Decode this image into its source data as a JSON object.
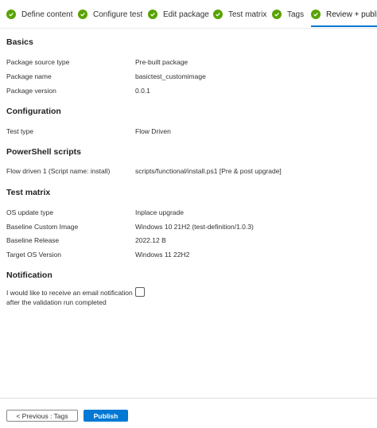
{
  "wizard": {
    "steps": [
      {
        "label": "Define content",
        "status": "complete"
      },
      {
        "label": "Configure test",
        "status": "complete"
      },
      {
        "label": "Edit package",
        "status": "complete"
      },
      {
        "label": "Test matrix",
        "status": "complete"
      },
      {
        "label": "Tags",
        "status": "complete"
      },
      {
        "label": "Review + publish",
        "status": "complete",
        "active": true
      }
    ],
    "check_color": "#57a300",
    "active_color": "#0078d4"
  },
  "basics": {
    "title": "Basics",
    "rows": [
      {
        "label": "Package source type",
        "value": "Pre-built package"
      },
      {
        "label": "Package name",
        "value": "basictest_customimage"
      },
      {
        "label": "Package version",
        "value": "0.0.1"
      }
    ]
  },
  "configuration": {
    "title": "Configuration",
    "rows": [
      {
        "label": "Test type",
        "value": "Flow Driven"
      }
    ]
  },
  "powershell": {
    "title": "PowerShell scripts",
    "rows": [
      {
        "label": "Flow driven 1 (Script name: install)",
        "value": "scripts/functional/install.ps1 [Pre & post upgrade]"
      }
    ]
  },
  "test_matrix": {
    "title": "Test matrix",
    "rows": [
      {
        "label": "OS update type",
        "value": "Inplace upgrade"
      },
      {
        "label": "Baseline Custom Image",
        "value": "Windows 10 21H2 (test-definition/1.0.3)"
      },
      {
        "label": "Baseline Release",
        "value": "2022.12 B"
      },
      {
        "label": "Target OS Version",
        "value": "Windows 11 22H2"
      }
    ]
  },
  "notification": {
    "title": "Notification",
    "label": "I would like to receive an email notification after the validation run completed",
    "checked": false
  },
  "footer": {
    "previous_label": "< Previous : Tags",
    "publish_label": "Publish",
    "publish_color": "#0078d4"
  }
}
